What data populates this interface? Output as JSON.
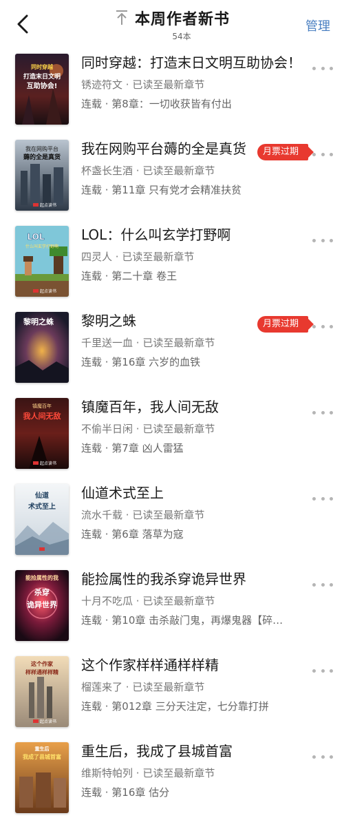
{
  "header": {
    "title": "本周作者新书",
    "subtitle": "54本",
    "manage": "管理",
    "back_icon": "chevron-left-icon",
    "top_icon": "arrow-up-to-top-icon"
  },
  "colors": {
    "accent": "#4a7fc1",
    "badge": "#e8392f"
  },
  "books": [
    {
      "title": "同时穿越：打造末日文明互助协会！",
      "author": "锈迹符文",
      "progress": "已读至最新章节",
      "latest": "连载 · 第8章：一切收获皆有付出",
      "badge": "",
      "cover_text": [
        "同时穿越",
        "打造末日文明",
        "互助协会!"
      ]
    },
    {
      "title": "我在网购平台薅的全是真货",
      "author": "杯盏长生酒",
      "progress": "已读至最新章节",
      "latest": "连载 · 第11章 只有党才会精准扶贫",
      "badge": "月票过期",
      "cover_text": [
        "我在网购平台",
        "薅的全是真货",
        ""
      ]
    },
    {
      "title": "LOL：什么叫玄学打野啊",
      "author": "四灵人",
      "progress": "已读至最新章节",
      "latest": "连载 · 第二十章 卷王",
      "badge": "",
      "cover_text": [
        "LOL",
        "什么叫玄学打野啊",
        ""
      ]
    },
    {
      "title": "黎明之蛛",
      "author": "千里送一血",
      "progress": "已读至最新章节",
      "latest": "连载 · 第16章 六岁的血铁",
      "badge": "月票过期",
      "cover_text": [
        "黎明之蛛",
        "",
        ""
      ]
    },
    {
      "title": "镇魔百年，我人间无敌",
      "author": "不偷半日闲",
      "progress": "已读至最新章节",
      "latest": "连载 · 第7章 凶人雷猛",
      "badge": "",
      "cover_text": [
        "镇魔百年",
        "我人间无敌",
        ""
      ]
    },
    {
      "title": "仙道术式至上",
      "author": "流水千载",
      "progress": "已读至最新章节",
      "latest": "连载 · 第6章 落草为寇",
      "badge": "",
      "cover_text": [
        "仙道",
        "术式至上",
        ""
      ]
    },
    {
      "title": "能捡属性的我杀穿诡异世界",
      "author": "十月不吃瓜",
      "progress": "已读至最新章节",
      "latest": "连载 · 第10章 击杀敲门鬼，再爆鬼器【碎…",
      "badge": "",
      "cover_text": [
        "能捡属性的我",
        "杀穿",
        "诡异世界"
      ]
    },
    {
      "title": "这个作家样样通样样精",
      "author": "榴莲来了",
      "progress": "已读至最新章节",
      "latest": "连载 · 第012章 三分天注定，七分靠打拼",
      "badge": "",
      "cover_text": [
        "这个作家",
        "样样通样样精",
        ""
      ]
    },
    {
      "title": "重生后，我成了县城首富",
      "author": "维斯特帕列",
      "progress": "已读至最新章节",
      "latest": "连载 · 第16章 估分",
      "badge": "",
      "cover_text": [
        "重生后",
        "我成了县城首富",
        ""
      ]
    }
  ]
}
